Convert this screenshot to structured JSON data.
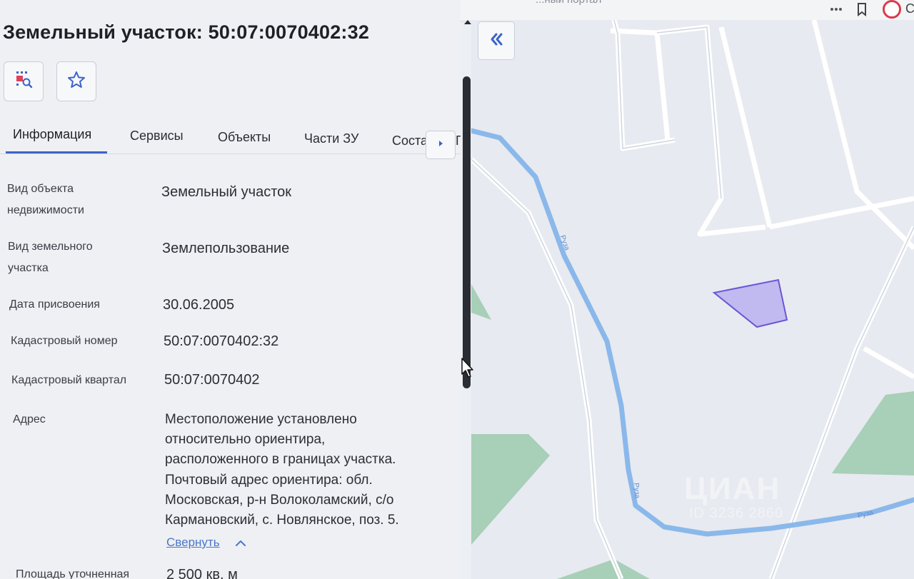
{
  "browser": {
    "title_fragment": "...ный портал",
    "profile_letter": "С"
  },
  "panel": {
    "title": "Земельный участок: 50:07:0070402:32",
    "tabs": [
      "Информация",
      "Сервисы",
      "Объекты",
      "Части ЗУ",
      "Соста"
    ],
    "tab_suffix": "Г",
    "properties": [
      {
        "label_lines": [
          "Вид объекта",
          "недвижимости"
        ],
        "value": "Земельный участок"
      },
      {
        "label_lines": [
          "Вид земельного",
          "участка"
        ],
        "value": "Землепользование"
      },
      {
        "label_lines": [
          "Дата присвоения"
        ],
        "value": "30.06.2005"
      },
      {
        "label_lines": [
          "Кадастровый номер"
        ],
        "value": "50:07:0070402:32"
      },
      {
        "label_lines": [
          "Кадастровый квартал"
        ],
        "value": "50:07:0070402"
      }
    ],
    "address": {
      "label": "Адрес",
      "lines": [
        "Местоположение установлено",
        "относительно ориентира,",
        "расположенного в границах участка.",
        "Почтовый адрес ориентира: обл.",
        "Московская, р-н Волоколамский, с/о",
        "Кармановский, с. Новлянское, поз. 5."
      ],
      "collapse_label": "Свернуть"
    },
    "area": {
      "label": "Площадь уточненная",
      "value": "2 500 кв. м"
    }
  },
  "map": {
    "river_labels": [
      "Руза",
      "Руза",
      "Руза"
    ],
    "watermark": "ЦИАН",
    "watermark_id": "ID 3236 2860",
    "colors": {
      "background": "#e7eaf0",
      "river": "#8ab8ea",
      "roads": "#ffffff",
      "forest": "#a8cfb8",
      "parcel_fill": "#b9b1f0",
      "parcel_stroke": "#6b55d6"
    }
  }
}
